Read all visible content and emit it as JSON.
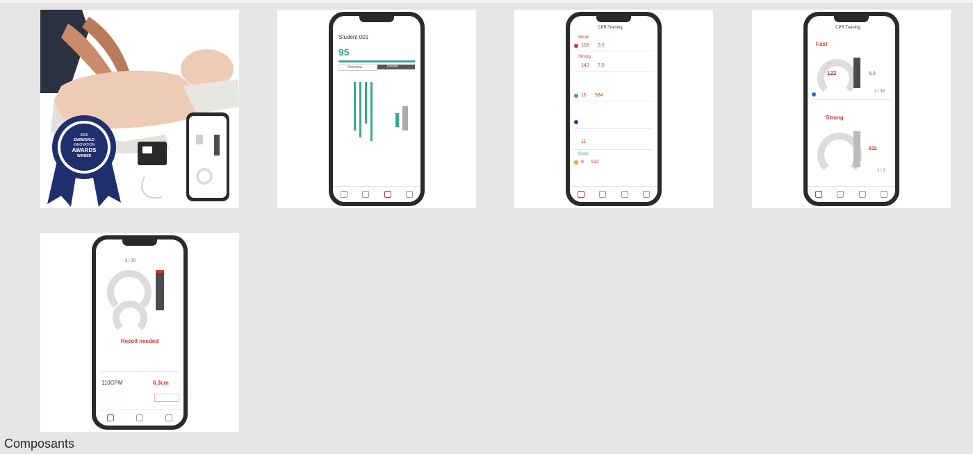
{
  "caption": "Composants",
  "thumbnails": [
    {
      "kind": "product-photo",
      "badge": {
        "year": "2020",
        "brand": "EMSWORLD",
        "line1": "INNOVATION",
        "line2": "AWARDS",
        "line3": "WINNER"
      }
    },
    {
      "kind": "phone-result",
      "student": "Student 001",
      "score": "95",
      "tabs": [
        "Overview",
        "Details"
      ]
    },
    {
      "kind": "phone-training-list",
      "title": "CPR Training",
      "rows": [
        {
          "label": "Weak",
          "value": "102",
          "unit": "5.5",
          "color": "#d23a2a"
        },
        {
          "label": "Strong",
          "value": "142",
          "unit": "7.5",
          "color": "#d23a2a"
        },
        {
          "label": "",
          "value": "16",
          "unit": "584",
          "color": "#3aa88f"
        },
        {
          "label": "",
          "value": "11",
          "unit": "",
          "color": "#5b2a86"
        },
        {
          "label": "Good",
          "value": "9",
          "unit": "532",
          "color": "#f0a020"
        }
      ]
    },
    {
      "kind": "phone-two-students",
      "title": "CPR Training",
      "top_status": "Fast",
      "top_rate": "122",
      "top_depth": "5.0",
      "top_count": "2 / 30",
      "bottom_status": "Strong",
      "bottom_depth": "632",
      "bottom_count": "1 / 2"
    },
    {
      "kind": "phone-feedback",
      "count": "3 / 30",
      "message": "Recoil needed",
      "rate": "110CPM",
      "depth": "6.3cm"
    }
  ],
  "colors": {
    "accent": "#d23a2a",
    "teal": "#3aa88f",
    "navy": "#1f2f6e"
  }
}
